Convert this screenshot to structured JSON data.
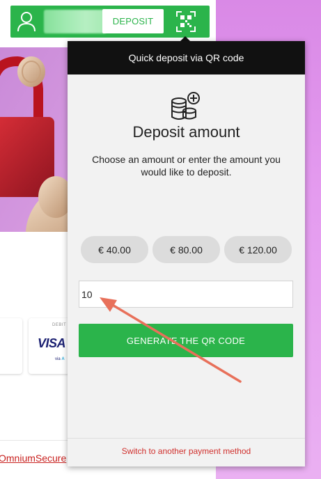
{
  "header": {
    "deposit_label": "DEPOSIT",
    "brand_color": "#2bb44b",
    "icons": {
      "user": "user-icon",
      "qr": "qr-code-icon"
    }
  },
  "quick_deposit": {
    "header_title": "Quick deposit via QR code",
    "icon": "coins-plus-icon",
    "title": "Deposit amount",
    "description": "Choose an amount or enter the amount you would like to deposit.",
    "amounts": [
      "€ 40.00",
      "€ 80.00",
      "€ 120.00"
    ],
    "input_value": "10",
    "generate_label": "GENERATE THE QR CODE",
    "switch_label": "Switch to another payment method"
  },
  "background": {
    "visa_card": {
      "debit": "DEBIT",
      "brand": "VISA",
      "via": "via"
    },
    "footer_link": "OmniumSecure"
  },
  "annotation": {
    "type": "arrow",
    "color": "#e8705a"
  }
}
